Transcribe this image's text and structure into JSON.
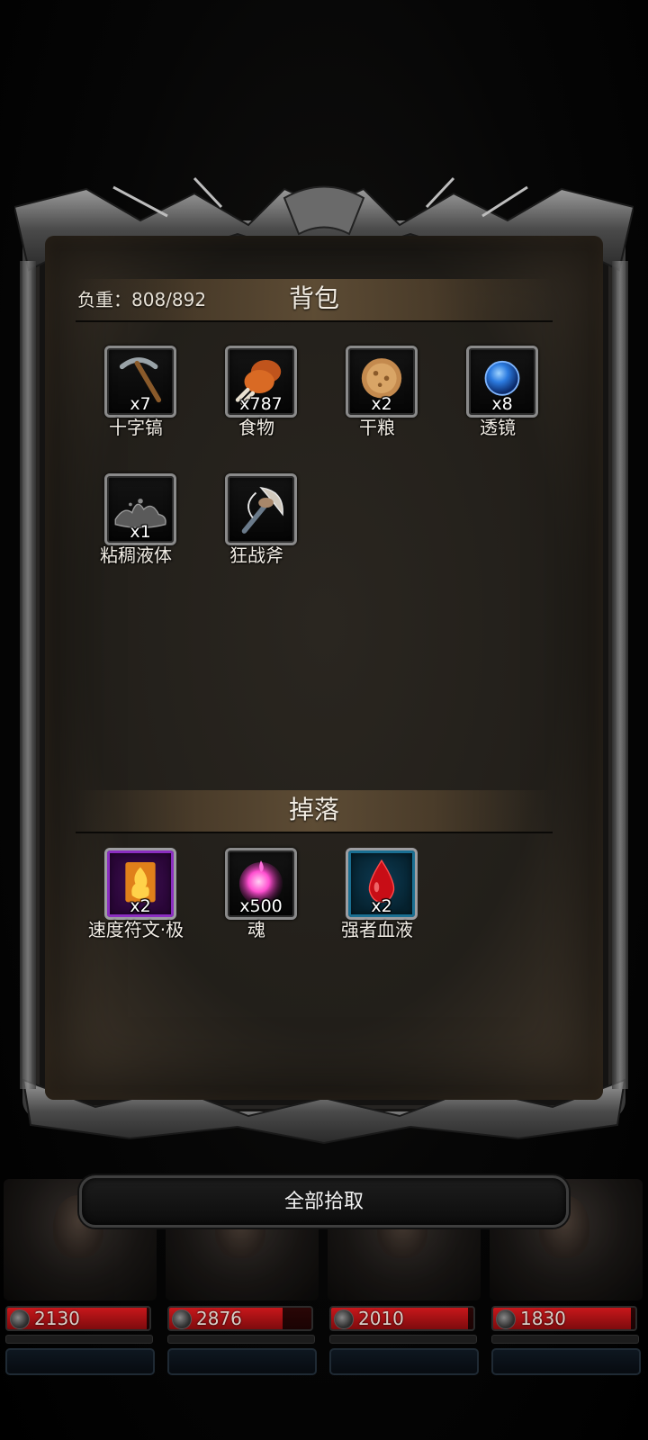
{
  "backpack": {
    "weight_label": "负重：808/892",
    "title": "背包",
    "items": [
      {
        "name": "十字镐",
        "count": "x7",
        "icon": "pickaxe-icon"
      },
      {
        "name": "食物",
        "count": "x787",
        "icon": "meat-drumstick-icon"
      },
      {
        "name": "干粮",
        "count": "x2",
        "icon": "bread-icon"
      },
      {
        "name": "透镜",
        "count": "x8",
        "icon": "blue-lens-orb-icon"
      },
      {
        "name": "粘稠液体",
        "count": "x1",
        "icon": "viscous-liquid-icon"
      },
      {
        "name": "狂战斧",
        "count": "",
        "icon": "battle-axe-icon"
      }
    ]
  },
  "drops": {
    "title": "掉落",
    "items": [
      {
        "name": "速度符文·极",
        "count": "x2",
        "icon": "fire-rune-icon",
        "frame_color": "#8b2ec0"
      },
      {
        "name": "魂",
        "count": "x500",
        "icon": "pink-soul-orb-icon"
      },
      {
        "name": "强者血液",
        "count": "x2",
        "icon": "blood-drop-icon",
        "frame_color": "#1a6f92"
      }
    ]
  },
  "collect_all": {
    "label": "全部拾取"
  },
  "heroes": [
    {
      "hp": "2130",
      "hp_fraction": 0.98
    },
    {
      "hp": "2876",
      "hp_fraction": 0.8
    },
    {
      "hp": "2010",
      "hp_fraction": 0.96
    },
    {
      "hp": "1830",
      "hp_fraction": 0.97
    }
  ],
  "colors": {
    "hp_bar": "#c8171b",
    "parchment": "#2a2620",
    "text": "#f2ede5"
  }
}
